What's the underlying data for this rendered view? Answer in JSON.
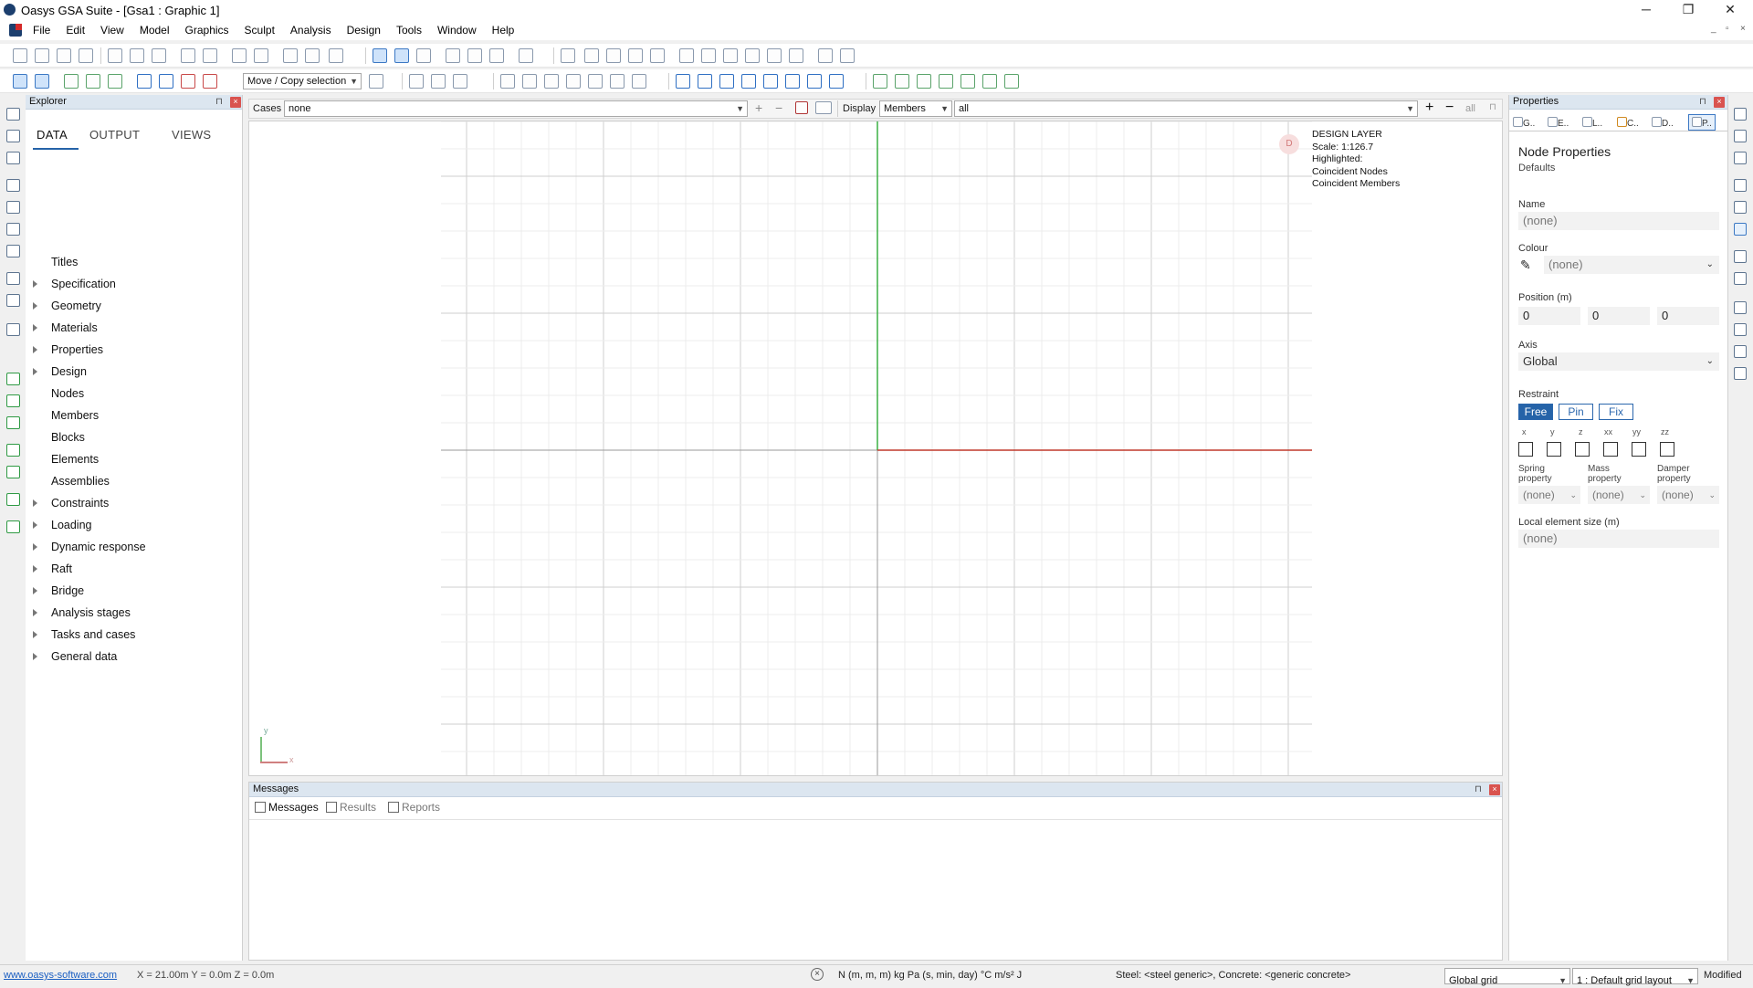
{
  "window": {
    "title": "Oasys GSA Suite - [Gsa1 : Graphic 1]",
    "minimize": "─",
    "restore": "❐",
    "close": "✕",
    "mdi_min": "_",
    "mdi_restore": "▫",
    "mdi_close": "×"
  },
  "menu": [
    "File",
    "Edit",
    "View",
    "Model",
    "Graphics",
    "Sculpt",
    "Analysis",
    "Design",
    "Tools",
    "Window",
    "Help"
  ],
  "toolbar2": {
    "move_copy": "Move / Copy selection"
  },
  "graphics_toolbar": {
    "cases_label": "Cases",
    "cases_value": "none",
    "display_label": "Display",
    "display_value": "Members",
    "filter_value": "all",
    "plus": "+",
    "minus": "−",
    "all_btn": "all"
  },
  "explorer": {
    "title": "Explorer",
    "tabs": [
      "DATA",
      "OUTPUT",
      "VIEWS"
    ],
    "items": [
      {
        "label": "Titles",
        "expandable": false
      },
      {
        "label": "Specification",
        "expandable": true
      },
      {
        "label": "Geometry",
        "expandable": true
      },
      {
        "label": "Materials",
        "expandable": true
      },
      {
        "label": "Properties",
        "expandable": true
      },
      {
        "label": "Design",
        "expandable": true
      },
      {
        "label": "Nodes",
        "expandable": false
      },
      {
        "label": "Members",
        "expandable": false
      },
      {
        "label": "Blocks",
        "expandable": false
      },
      {
        "label": "Elements",
        "expandable": false
      },
      {
        "label": "Assemblies",
        "expandable": false
      },
      {
        "label": "Constraints",
        "expandable": true
      },
      {
        "label": "Loading",
        "expandable": true
      },
      {
        "label": "Dynamic response",
        "expandable": true
      },
      {
        "label": "Raft",
        "expandable": true
      },
      {
        "label": "Bridge",
        "expandable": true
      },
      {
        "label": "Analysis stages",
        "expandable": true
      },
      {
        "label": "Tasks and cases",
        "expandable": true
      },
      {
        "label": "General data",
        "expandable": true
      }
    ]
  },
  "graphics": {
    "badge": "D",
    "overlay": [
      "DESIGN LAYER",
      "Scale: 1:126.7",
      "Highlighted:",
      "Coincident Nodes",
      "Coincident Members"
    ],
    "axis_y": "y",
    "axis_x": "x"
  },
  "properties": {
    "title": "Properties",
    "tabs": [
      "G..",
      "E..",
      "L..",
      "C..",
      "D..",
      "P.."
    ],
    "heading": "Node Properties",
    "subheading": "Defaults",
    "name_label": "Name",
    "name_value": "(none)",
    "colour_label": "Colour",
    "colour_value": "(none)",
    "position_label": "Position (m)",
    "position": [
      "0",
      "0",
      "0"
    ],
    "axis_label": "Axis",
    "axis_value": "Global",
    "restraint_label": "Restraint",
    "restraint_buttons": [
      "Free",
      "Pin",
      "Fix"
    ],
    "restraint_dofs": [
      "x",
      "y",
      "z",
      "xx",
      "yy",
      "zz"
    ],
    "spring_label_1": "Spring",
    "spring_label_2": "property",
    "spring_value": "(none)",
    "mass_label_1": "Mass",
    "mass_label_2": "property",
    "mass_value": "(none)",
    "damper_label_1": "Damper",
    "damper_label_2": "property",
    "damper_value": "(none)",
    "element_size_label": "Local element size (m)",
    "element_size_value": "(none)"
  },
  "messages": {
    "title": "Messages",
    "tabs": [
      "Messages",
      "Results",
      "Reports"
    ]
  },
  "status": {
    "link": "www.oasys-software.com",
    "coords": "X = 21.00m   Y = 0.0m   Z = 0.0m",
    "units": "N  (m, m, m)  kg  Pa  (s, min, day)  °C  m/s²  J",
    "materials": "Steel: <steel generic>, Concrete: <generic concrete>",
    "grid": "Global grid",
    "layout": "1 : Default grid layout",
    "state": "Modified"
  },
  "colors": {
    "accent": "#2563a8",
    "x_axis": "#c0392b",
    "y_axis": "#3cb043",
    "panel_head": "#dce6f0"
  }
}
